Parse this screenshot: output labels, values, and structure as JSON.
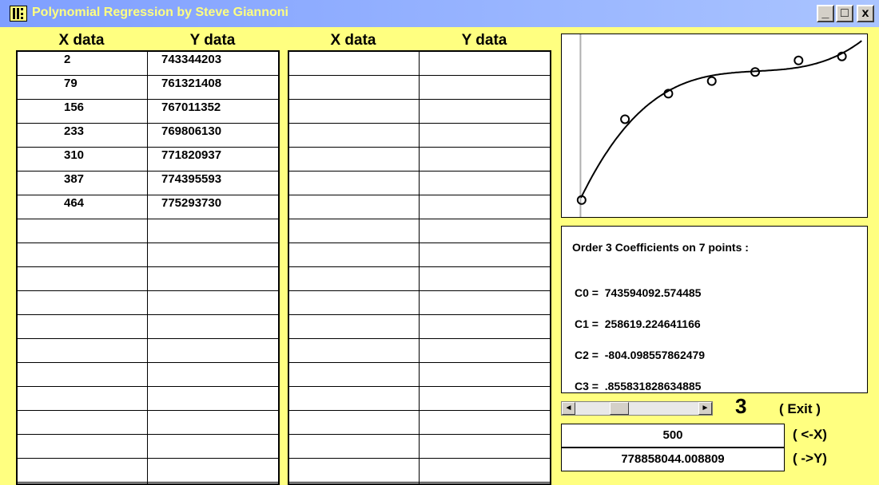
{
  "window": {
    "title": "Polynomial Regression  by Steve Giannoni",
    "minimize_label": "_",
    "maximize_label": "□",
    "close_label": "x"
  },
  "table_left": {
    "headers": [
      "X data",
      "Y data"
    ],
    "rows": [
      [
        "2",
        "743344203"
      ],
      [
        "79",
        "761321408"
      ],
      [
        "156",
        "767011352"
      ],
      [
        "233",
        "769806130"
      ],
      [
        "310",
        "771820937"
      ],
      [
        "387",
        "774395593"
      ],
      [
        "464",
        "775293730"
      ],
      [
        "",
        ""
      ],
      [
        "",
        ""
      ],
      [
        "",
        ""
      ],
      [
        "",
        ""
      ],
      [
        "",
        ""
      ],
      [
        "",
        ""
      ],
      [
        "",
        ""
      ],
      [
        "",
        ""
      ],
      [
        "",
        ""
      ],
      [
        "",
        ""
      ],
      [
        "",
        ""
      ]
    ]
  },
  "table_right": {
    "headers": [
      "X data",
      "Y data"
    ],
    "rows": [
      [
        "",
        ""
      ],
      [
        "",
        ""
      ],
      [
        "",
        ""
      ],
      [
        "",
        ""
      ],
      [
        "",
        ""
      ],
      [
        "",
        ""
      ],
      [
        "",
        ""
      ],
      [
        "",
        ""
      ],
      [
        "",
        ""
      ],
      [
        "",
        ""
      ],
      [
        "",
        ""
      ],
      [
        "",
        ""
      ],
      [
        "",
        ""
      ],
      [
        "",
        ""
      ],
      [
        "",
        ""
      ],
      [
        "",
        ""
      ],
      [
        "",
        ""
      ],
      [
        "",
        ""
      ]
    ]
  },
  "chart_data": {
    "type": "scatter",
    "x": [
      2,
      79,
      156,
      233,
      310,
      387,
      464
    ],
    "y": [
      743344203,
      761321408,
      767011352,
      769806130,
      771820937,
      774395593,
      775293730
    ],
    "fit": {
      "order": 3,
      "coefficients": [
        743594092.574485,
        258619.224641166,
        -804.098557862479,
        0.855831828634885
      ]
    },
    "xlim": [
      -2,
      500
    ],
    "ylim": [
      741000000,
      779500000
    ],
    "grid": false,
    "title": "",
    "xlabel": "",
    "ylabel": ""
  },
  "coefficients_panel": {
    "heading": "Order 3 Coefficients on 7 points :",
    "lines": [
      "C0 =  743594092.574485",
      "C1 =  258619.224641166",
      "C2 =  -804.098557862479",
      "C3 =  .855831828634885"
    ]
  },
  "controls": {
    "order_value": "3",
    "order_level": 0.33,
    "exit_label": "( Exit )",
    "x_input_value": "500",
    "y_output_value": "778858044.008809",
    "x_label": "( <-X)",
    "y_label": "( ->Y)",
    "scroll_left_icon": "◄",
    "scroll_right_icon": "►"
  }
}
